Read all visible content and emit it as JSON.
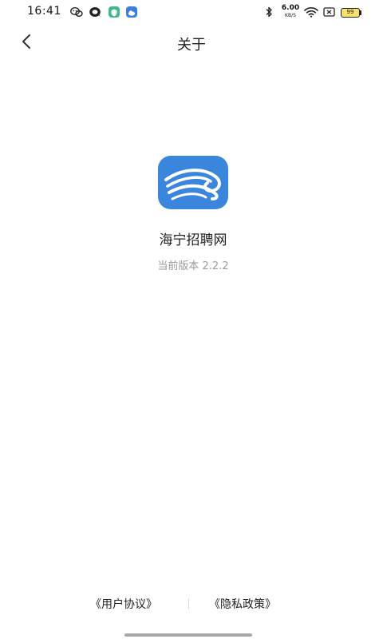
{
  "status_bar": {
    "time": "16:41",
    "net_speed_value": "6.00",
    "net_speed_unit": "KB/S",
    "battery_level": "99",
    "icons": [
      "wechat-icon",
      "chat-bubble-icon",
      "security-app-icon",
      "cloud-app-icon",
      "bluetooth-icon",
      "wifi-icon",
      "sim-icon",
      "battery-icon"
    ]
  },
  "nav": {
    "title": "关于",
    "back_icon": "chevron-left-icon"
  },
  "app": {
    "name": "海宁招聘网",
    "version_label": "当前版本 2.2.2",
    "logo_icon": "wave-logo-icon"
  },
  "footer": {
    "user_agreement": "《用户协议》",
    "privacy_policy": "《隐私政策》"
  },
  "colors": {
    "logo_blue": "#3b86dd",
    "muted_text": "#9a9a9a",
    "battery_fill": "#f7e36c"
  }
}
